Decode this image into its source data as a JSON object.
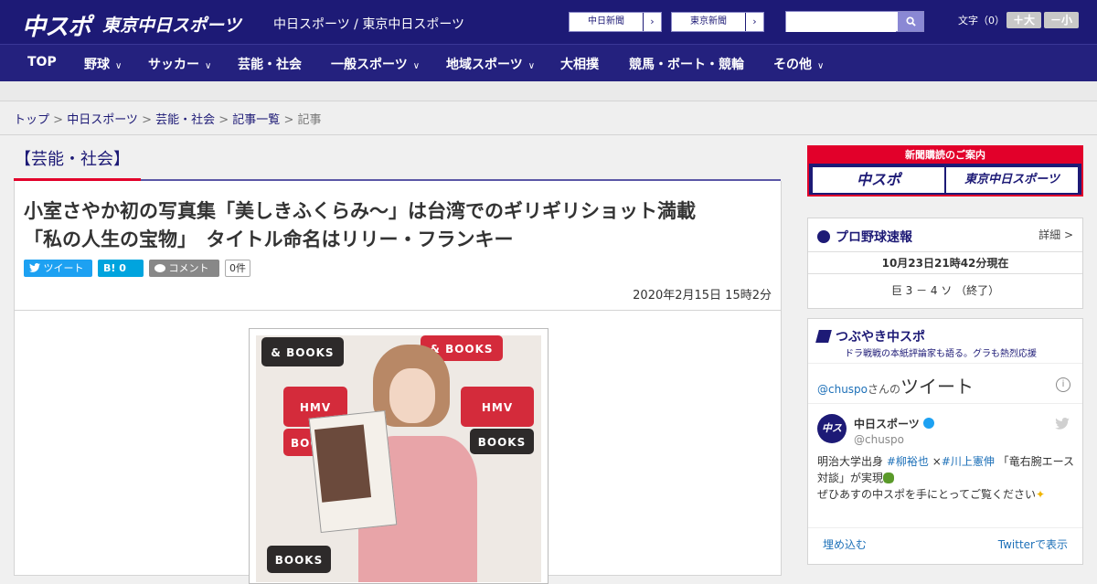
{
  "header": {
    "logo_main": "中スポ",
    "logo_tokyo": "東京中日スポーツ",
    "site_name": "中日スポーツ / 東京中日スポーツ",
    "paper_links": [
      {
        "label": "中日新聞",
        "arrow": "›"
      },
      {
        "label": "東京新聞",
        "arrow": "›"
      }
    ],
    "search_placeholder": "",
    "search_icon": "search-icon",
    "font_size_label": "文字（0）",
    "font_larger": "＋大",
    "font_smaller": "－小"
  },
  "nav": {
    "items": [
      {
        "label": "TOP",
        "dropdown": false
      },
      {
        "label": "野球",
        "dropdown": true
      },
      {
        "label": "サッカー",
        "dropdown": true
      },
      {
        "label": "芸能・社会",
        "dropdown": false
      },
      {
        "label": "一般スポーツ",
        "dropdown": true
      },
      {
        "label": "地域スポーツ",
        "dropdown": true
      },
      {
        "label": "大相撲",
        "dropdown": false
      },
      {
        "label": "競馬・ボート・競輪",
        "dropdown": false
      },
      {
        "label": "その他",
        "dropdown": true
      }
    ],
    "chevron": "∨"
  },
  "breadcrumb": {
    "items": [
      "トップ",
      "中日スポーツ",
      "芸能・社会",
      "記事一覧"
    ],
    "sep": " > ",
    "current": "記事"
  },
  "article": {
    "category": "【芸能・社会】",
    "headline_line1": "小室さやか初の写真集「美しきふくらみ～」は台湾でのギリギリショット満載",
    "headline_line2": "「私の人生の宝物」　タイトル命名はリリー・フランキー",
    "share": {
      "tweet": "ツイート",
      "hatena": "B! 0",
      "comment": "コメント",
      "comment_count": "0件"
    },
    "date": "2020年2月15日 15時2分",
    "photo_brands": [
      "& BOOKS",
      "& BOOKS",
      "HMV",
      "HMV",
      "BOOKS",
      "BOOKS",
      "BOOKS"
    ]
  },
  "sidebar": {
    "promo": {
      "heading": "新聞購読のご案内",
      "paper1": "中スポ",
      "paper2": "東京中日スポーツ"
    },
    "baseball": {
      "title": "プロ野球速報",
      "details": "詳細 >",
      "updated": "10月23日21時42分現在",
      "score": "巨 3 － 4 ソ （終了）"
    },
    "tsubuyaki": {
      "title": "つぶやき中スポ",
      "subtitle": "ドラ戦戦の本紙評論家も語る。グラも熱烈応援",
      "tweets_by_prefix": "@chuspo",
      "tweets_by_suffix": "さんの",
      "tweets_word": "ツイート",
      "account_name": "中日スポーツ",
      "account_handle": "@chuspo",
      "tweet_line1_pre": "明治大学出身 ",
      "tweet_tag1": "#柳裕也",
      "tweet_x": " ×",
      "tweet_tag2": "#川上憲伸",
      "tweet_line1_post": " 「竜右腕エース",
      "tweet_line2": "対談」が実現",
      "tweet_line3": "ぜひあすの中スポを手にとってご覧ください",
      "embed": "埋め込む",
      "view_on_twitter": "Twitterで表示"
    }
  },
  "colors": {
    "navy": "#1d1a76",
    "red": "#e2002a",
    "twitter": "#1da1f2",
    "hatena": "#00a4de"
  }
}
